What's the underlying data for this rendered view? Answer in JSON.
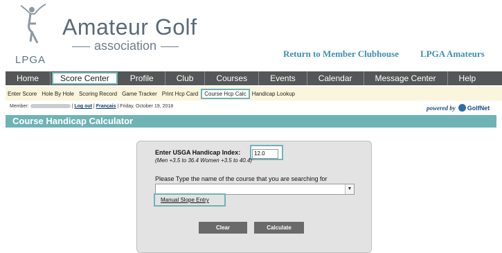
{
  "header": {
    "brand_main": "Amateur Golf",
    "brand_sub": "association",
    "lpga": "LPGA",
    "links": [
      "Return to Member Clubhouse",
      "LPGA Amateurs"
    ]
  },
  "mainnav": [
    "Home",
    "Score Center",
    "Profile",
    "Club",
    "Courses",
    "Events",
    "Calendar",
    "Message Center",
    "Help"
  ],
  "subnav": [
    "Enter Score",
    "Hole By Hole",
    "Scoring Record",
    "Game Tracker",
    "Print Hcp Card",
    "Course Hcp Calc",
    "Handicap Lookup"
  ],
  "memberline": {
    "member_label": "Member:",
    "logout": "Log out",
    "francais": "Français",
    "date": "Friday, October 19, 2018",
    "sep": "|"
  },
  "powered": {
    "text": "powered by",
    "brand": "GolfNet"
  },
  "title": "Course Handicap Calculator",
  "calculator": {
    "index_label": "Enter USGA Handicap Index:",
    "index_value": "12.0",
    "range_note": "(Men +3.5 to 36.4 Women +3.5 to 40.4)",
    "course_label": "Please Type the name of the course that you are searching for",
    "course_value": "",
    "manual_link": "Manual Slope Entry",
    "clear_label": "Clear",
    "calculate_label": "Calculate"
  },
  "colors": {
    "accent": "#6fb3b5",
    "nav_bg": "#555657",
    "subnav_bg": "#faf5dc",
    "link": "#3d8fb1"
  }
}
